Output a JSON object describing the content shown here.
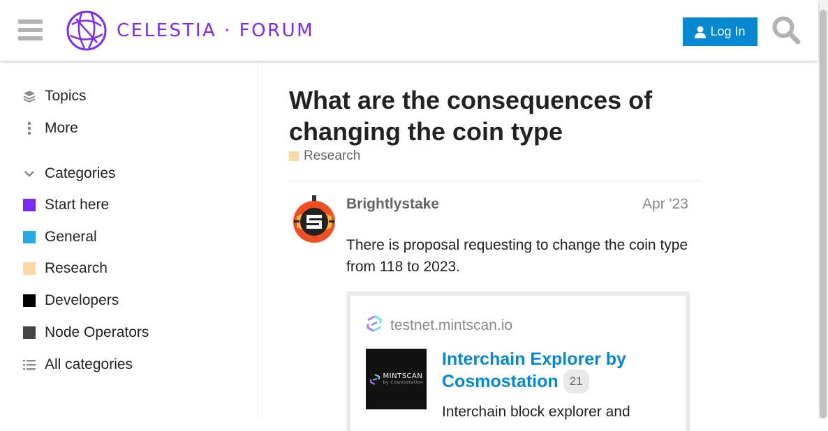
{
  "header": {
    "logo_text": "CELESTIA · FORUM",
    "login_label": "Log In",
    "brand_color": "#7b2bf9",
    "button_color": "#0688d1"
  },
  "sidebar": {
    "items": [
      {
        "label": "Topics",
        "icon": "layers-icon"
      },
      {
        "label": "More",
        "icon": "ellipsis-vertical-icon"
      }
    ],
    "categories_header": "Categories",
    "categories": [
      {
        "label": "Start here",
        "color": "#7b2bf9"
      },
      {
        "label": "General",
        "color": "#25aae1"
      },
      {
        "label": "Research",
        "color": "#fbd9a7"
      },
      {
        "label": "Developers",
        "color": "#000000"
      },
      {
        "label": "Node Operators",
        "color": "#444444"
      }
    ],
    "all_categories": "All categories"
  },
  "topic": {
    "title": "What are the consequences of changing the coin type",
    "category": "Research",
    "category_color": "#fbd9a7"
  },
  "post": {
    "username": "Brightlystake",
    "date": "Apr '23",
    "body": "There is proposal requesting to change the coin type from 118 to 2023.",
    "onebox": {
      "site": "testnet.mintscan.io",
      "thumb_text": "MINTSCAN",
      "thumb_sub": "by Cosmostation",
      "title": "Interchain Explorer by Cosmostation",
      "count": "21",
      "description": "Interchain block explorer and"
    }
  }
}
